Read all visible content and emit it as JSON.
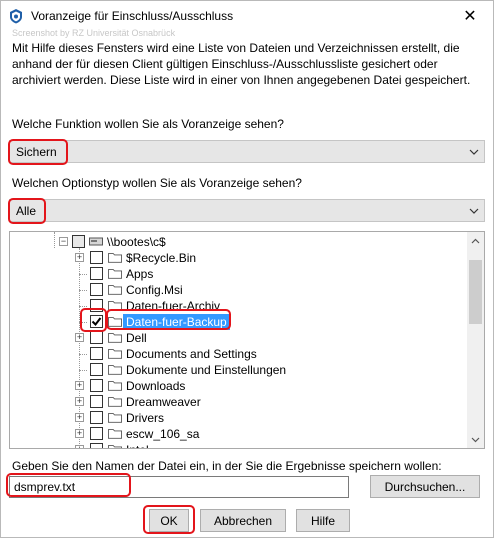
{
  "window": {
    "title": "Voranzeige für Einschluss/Ausschluss",
    "close_glyph": "✕",
    "watermark": "Screenshot by RZ Universität Osnabrück"
  },
  "description": "Mit Hilfe dieses Fensters wird eine Liste von Dateien und Verzeichnissen erstellt, die anhand der für diesen Client gültigen Einschluss-/Ausschlussliste gesichert oder archiviert werden. Diese Liste wird in einer von Ihnen angegebenen Datei gespeichert.",
  "function_label": "Welche Funktion wollen Sie als Voranzeige sehen?",
  "function_value": "Sichern",
  "option_label": "Welchen Optionstyp wollen Sie als Voranzeige sehen?",
  "option_value": "Alle",
  "tree": {
    "root_label": "\\\\bootes\\c$",
    "items": [
      {
        "label": "$Recycle.Bin",
        "expandable": true,
        "checked": false,
        "selected": false
      },
      {
        "label": "Apps",
        "expandable": false,
        "checked": false,
        "selected": false
      },
      {
        "label": "Config.Msi",
        "expandable": false,
        "checked": false,
        "selected": false
      },
      {
        "label": "Daten-fuer-Archiv",
        "expandable": false,
        "checked": false,
        "selected": false
      },
      {
        "label": "Daten-fuer-Backup",
        "expandable": false,
        "checked": true,
        "selected": true
      },
      {
        "label": "Dell",
        "expandable": true,
        "checked": false,
        "selected": false
      },
      {
        "label": "Documents and Settings",
        "expandable": false,
        "checked": false,
        "selected": false
      },
      {
        "label": "Dokumente und Einstellungen",
        "expandable": false,
        "checked": false,
        "selected": false
      },
      {
        "label": "Downloads",
        "expandable": true,
        "checked": false,
        "selected": false
      },
      {
        "label": "Dreamweaver",
        "expandable": true,
        "checked": false,
        "selected": false
      },
      {
        "label": "Drivers",
        "expandable": true,
        "checked": false,
        "selected": false
      },
      {
        "label": "escw_106_sa",
        "expandable": true,
        "checked": false,
        "selected": false
      },
      {
        "label": "Intel",
        "expandable": true,
        "checked": false,
        "selected": false
      }
    ]
  },
  "filename_label": "Geben Sie den Namen der Datei ein, in der Sie die Ergebnisse speichern wollen:",
  "filename_value": "dsmprev.txt",
  "browse_button": "Durchsuchen...",
  "ok_button": "OK",
  "cancel_button": "Abbrechen",
  "help_button": "Hilfe",
  "colors": {
    "highlight_red": "#e3151b",
    "selection_blue": "#3399ff"
  }
}
